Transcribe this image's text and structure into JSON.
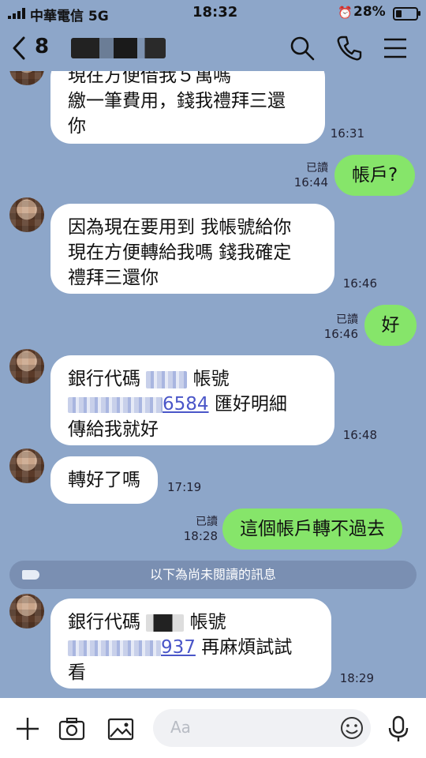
{
  "status_bar": {
    "carrier": "中華電信 5G",
    "time": "18:32",
    "battery": "28%"
  },
  "header": {
    "back_count": "8"
  },
  "messages": [
    {
      "text": "現在方便借我５萬嗎\n繳一筆費用，錢我禮拜三還\n你",
      "time": "16:31"
    },
    {
      "text": "帳戶?",
      "read": "已讀",
      "time": "16:44"
    },
    {
      "text": "因為現在要用到 我帳號給你\n現在方便轉給我嗎 錢我確定\n禮拜三還你",
      "time": "16:46"
    },
    {
      "text": "好",
      "read": "已讀",
      "time": "16:46"
    },
    {
      "line1": "銀行代碼",
      "line1_suffix": "帳號",
      "acct": "6584",
      "line2_suffix": " 匯好明細",
      "line3": "傳給我就好",
      "time": "16:48"
    },
    {
      "text": "轉好了嗎",
      "time": "17:19"
    },
    {
      "text": "這個帳戶轉不過去",
      "read": "已讀",
      "time": "18:28"
    },
    {
      "line1": "銀行代碼",
      "line1_suffix": "帳號",
      "acct": "937",
      "line2_suffix": " 再麻煩試試",
      "line3": "看",
      "time": "18:29"
    }
  ],
  "unread_divider": "以下為尚未閱讀的訊息",
  "input": {
    "placeholder": "Aa"
  },
  "colors": {
    "background": "#8da6c9",
    "outgoing": "#86e56a",
    "incoming": "#ffffff"
  }
}
